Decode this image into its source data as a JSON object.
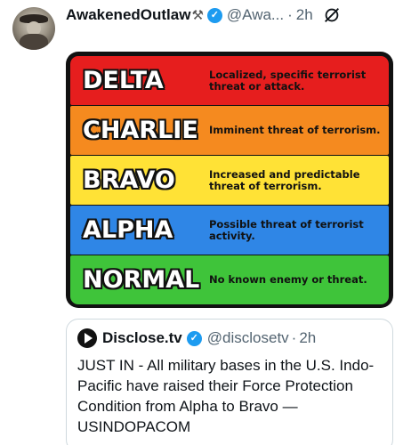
{
  "tweet": {
    "author_name": "AwakenedOutlaw",
    "author_name_icon": "hammer-pick-icon",
    "handle": "@Awa...",
    "separator": "·",
    "time": "2h",
    "grok_icon": "grok-icon"
  },
  "fpcon": {
    "levels": [
      {
        "level": "DELTA",
        "description": "Localized, specific terrorist threat or attack.",
        "color": "#e61e1e"
      },
      {
        "level": "CHARLIE",
        "description": "Imminent threat of terrorism.",
        "color": "#f58a1f"
      },
      {
        "level": "BRAVO",
        "description": "Increased and predictable threat of terrorism.",
        "color": "#ffe236"
      },
      {
        "level": "ALPHA",
        "description": "Possible threat of terrorist activity.",
        "color": "#2f86e6"
      },
      {
        "level": "NORMAL",
        "description": "No known enemy or threat.",
        "color": "#3fc43a"
      }
    ]
  },
  "quoted": {
    "name": "Disclose.tv",
    "handle": "@disclosetv",
    "separator": "·",
    "time": "2h",
    "text": "JUST IN - All military bases in the U.S. Indo-Pacific have raised their Force Protection Condition from Alpha to Bravo — USINDOPACOM"
  },
  "colors": {
    "verified": "#1d9bf0",
    "secondary_text": "#536471"
  }
}
